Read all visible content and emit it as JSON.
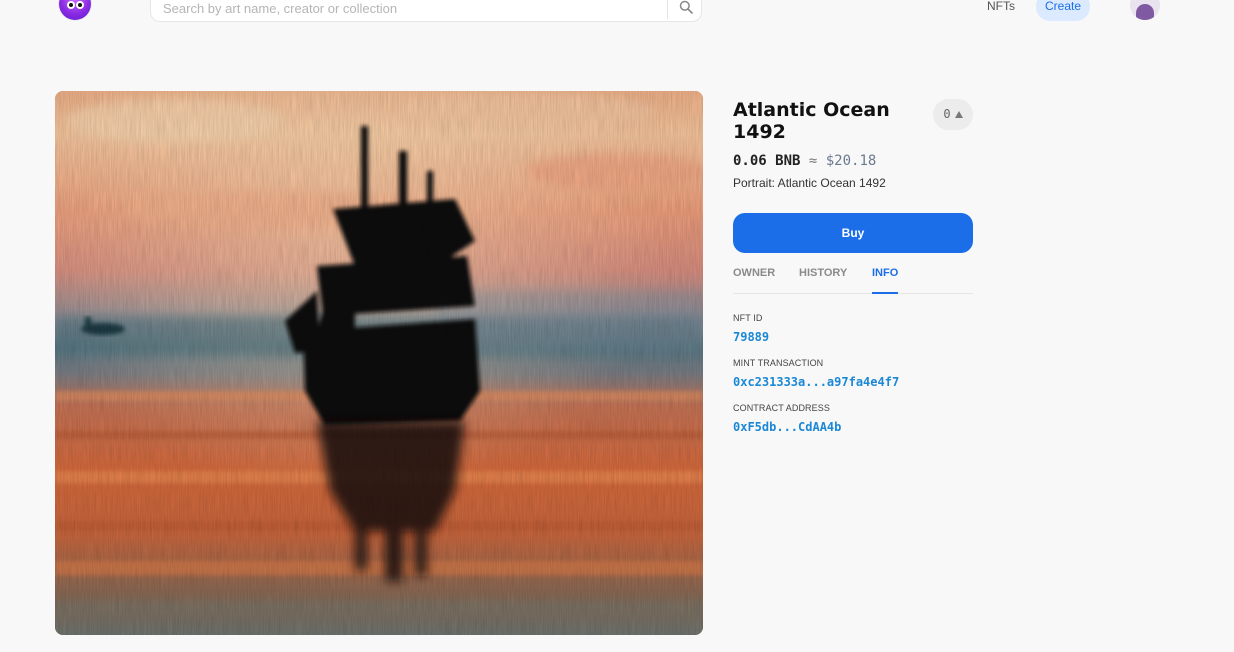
{
  "header": {
    "logo_icon": "ghost-mascot-logo-icon",
    "search_placeholder": "Search by art name, creator or collection",
    "search_icon": "search-icon",
    "nav_nfts": "NFTs",
    "create_label": "Create",
    "avatar_icon": "user-avatar-icon"
  },
  "artwork": {
    "alt": "Atlantic Ocean 1492"
  },
  "details": {
    "title": "Atlantic Ocean 1492",
    "likes": "0",
    "like_icon": "triangle-up-icon",
    "price_amount": "0.06 BNB",
    "price_approx": "≈",
    "price_usd": "$20.18",
    "portrait": "Portrait: Atlantic Ocean 1492",
    "buy_label": "Buy",
    "tabs": [
      {
        "label": "OWNER",
        "active": false
      },
      {
        "label": "HISTORY",
        "active": false
      },
      {
        "label": "INFO",
        "active": true
      }
    ],
    "info": [
      {
        "label": "NFT ID",
        "value": "79889"
      },
      {
        "label": "MINT TRANSACTION",
        "value": "0xc231333a...a97fa4e4f7"
      },
      {
        "label": "CONTRACT ADDRESS",
        "value": "0xF5db...CdAA4b"
      }
    ]
  },
  "colors": {
    "accent": "#1b6ee8",
    "link": "#1b88d6",
    "create_bg": "#dbeafe",
    "background": "#f8f8f8"
  }
}
